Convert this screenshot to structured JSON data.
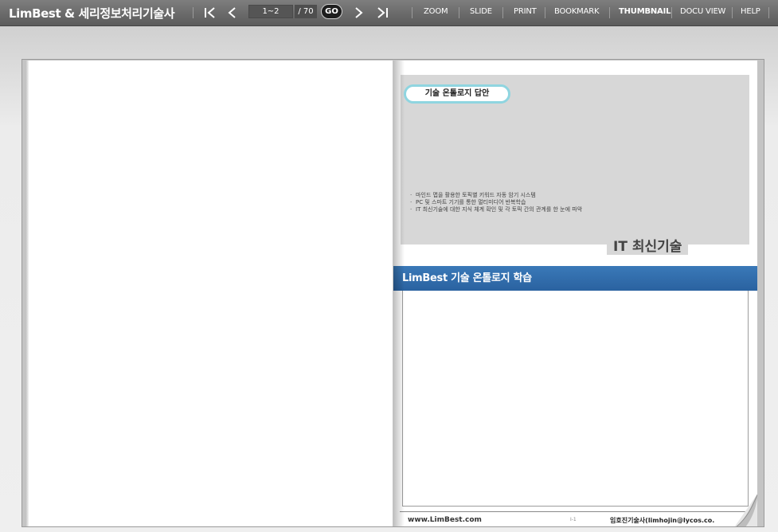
{
  "toolbar": {
    "app_title": "LimBest & 세리정보처리기술사",
    "page_value": "1~2",
    "page_total": "/ 70",
    "go_label": "GO",
    "menu": {
      "zoom": "ZOOM",
      "slide": "SLIDE",
      "print": "PRINT",
      "bookmark": "BOOKMARK",
      "thumbnail": "THUMBNAIL",
      "docu_view": "DOCU VIEW",
      "help": "HELP"
    },
    "icons": {
      "first": "first-page-icon",
      "prev": "previous-page-icon",
      "next": "next-page-icon",
      "last": "last-page-icon"
    }
  },
  "right_page": {
    "badge": "기술 온톨로지 답안",
    "bullets": [
      "마인드 맵을 활용한 토픽별 키워드 자동 암기 시스템",
      "PC 및 스마트 기기를 통한 멀티미디어 반복학습",
      "IT 최신기술에 대한 지식 체계 확인 및 각 토픽 간의 관계를 한 눈에 파악"
    ],
    "cover_title": "IT 최신기술",
    "band_title": "LimBest 기술 온톨로지 학습",
    "footer_url": "www.LimBest.com",
    "footer_page": "I-1",
    "footer_author": "임호진기술사(limhojin@lycos.co."
  },
  "colors": {
    "toolbar": "#6a6a6a",
    "band": "#2f6aa8",
    "badge_border": "#8fd5e0",
    "cover_panel": "#d7d7d7"
  }
}
